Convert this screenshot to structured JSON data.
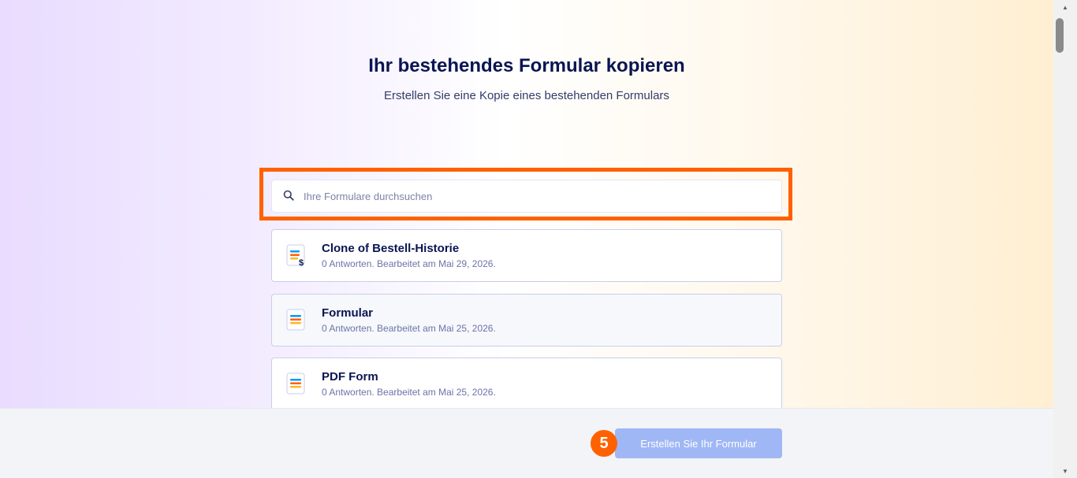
{
  "header": {
    "title": "Ihr bestehendes Formular kopieren",
    "subtitle": "Erstellen Sie eine Kopie eines bestehenden Formulars"
  },
  "search": {
    "placeholder": "Ihre Formulare durchsuchen",
    "value": "",
    "highlight_color": "#ff6100"
  },
  "forms": [
    {
      "title": "Clone of Bestell-Historie",
      "meta": "0 Antworten. Bearbeitet am Mai 29, 2026.",
      "icon": "payment-form-icon"
    },
    {
      "title": "Formular",
      "meta": "0 Antworten. Bearbeitet am Mai 25, 2026.",
      "icon": "form-icon"
    },
    {
      "title": "PDF Form",
      "meta": "0 Antworten. Bearbeitet am Mai 25, 2026.",
      "icon": "form-icon"
    }
  ],
  "footer": {
    "step_number": "5",
    "create_label": "Erstellen Sie Ihr Formular",
    "button_color": "#a0b7f5",
    "badge_color": "#ff6100"
  },
  "colors": {
    "title": "#0a1551",
    "accent": "#ff6100"
  }
}
